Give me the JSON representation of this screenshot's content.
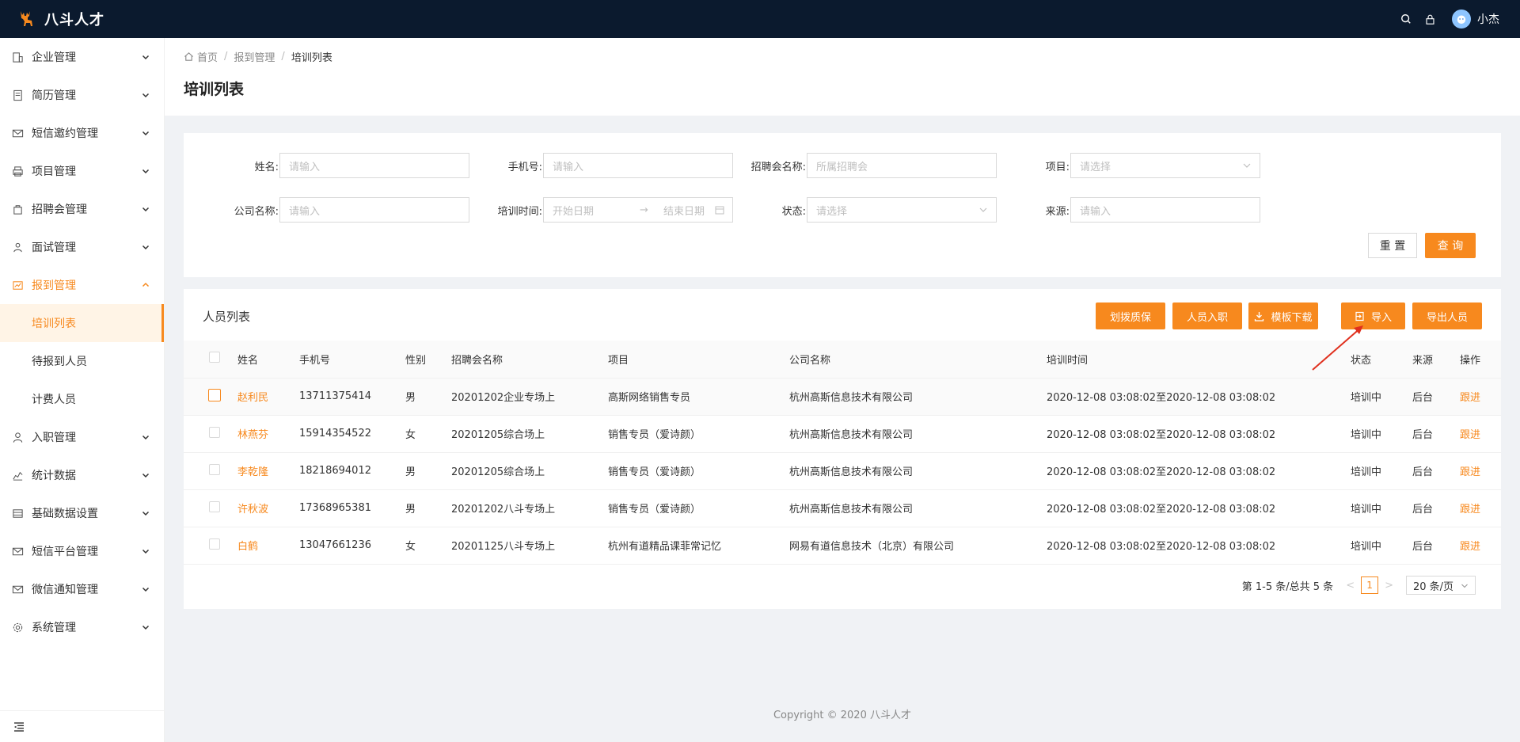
{
  "app": {
    "name": "八斗人才",
    "username": "小杰"
  },
  "colors": {
    "accent": "#f7891e",
    "topbar": "#0b1a2e"
  },
  "sidebar": {
    "items": [
      {
        "label": "企业管理",
        "icon": "building-icon"
      },
      {
        "label": "简历管理",
        "icon": "document-icon"
      },
      {
        "label": "短信邀约管理",
        "icon": "mail-icon"
      },
      {
        "label": "项目管理",
        "icon": "printer-icon"
      },
      {
        "label": "招聘会管理",
        "icon": "bag-icon"
      },
      {
        "label": "面试管理",
        "icon": "people-icon"
      },
      {
        "label": "报到管理",
        "icon": "chart-icon"
      },
      {
        "label": "入职管理",
        "icon": "user-icon"
      },
      {
        "label": "统计数据",
        "icon": "stats-icon"
      },
      {
        "label": "基础数据设置",
        "icon": "database-icon"
      },
      {
        "label": "短信平台管理",
        "icon": "mail-icon"
      },
      {
        "label": "微信通知管理",
        "icon": "mail-icon"
      },
      {
        "label": "系统管理",
        "icon": "gear-icon"
      }
    ],
    "sub_items": [
      "培训列表",
      "待报到人员",
      "计费人员"
    ]
  },
  "breadcrumb": {
    "home": "首页",
    "parent": "报到管理",
    "current": "培训列表"
  },
  "page_title": "培训列表",
  "search": {
    "name_label": "姓名:",
    "name_placeholder": "请输入",
    "phone_label": "手机号:",
    "phone_placeholder": "请输入",
    "fair_label": "招聘会名称:",
    "fair_placeholder": "所属招聘会",
    "project_label": "项目:",
    "project_placeholder": "请选择",
    "company_label": "公司名称:",
    "company_placeholder": "请输入",
    "time_label": "培训时间:",
    "start_placeholder": "开始日期",
    "end_placeholder": "结束日期",
    "status_label": "状态:",
    "status_placeholder": "请选择",
    "source_label": "来源:",
    "source_placeholder": "请输入",
    "reset_label": "重 置",
    "query_label": "查 询"
  },
  "list": {
    "title": "人员列表",
    "buttons": [
      "划拨质保",
      "人员入职",
      "模板下载",
      "导入",
      "导出人员"
    ],
    "columns": [
      "姓名",
      "手机号",
      "性别",
      "招聘会名称",
      "项目",
      "公司名称",
      "培训时间",
      "状态",
      "来源",
      "操作"
    ],
    "rows": [
      {
        "name": "赵利民",
        "phone": "13711375414",
        "gender": "男",
        "fair": "20201202企业专场上",
        "project": "高斯网络销售专员",
        "company": "杭州高斯信息技术有限公司",
        "time": "2020-12-08 03:08:02至2020-12-08 03:08:02",
        "status": "培训中",
        "source": "后台",
        "op": "跟进"
      },
      {
        "name": "林燕芬",
        "phone": "15914354522",
        "gender": "女",
        "fair": "20201205综合场上",
        "project": "销售专员（爱诗颜）",
        "company": "杭州高斯信息技术有限公司",
        "time": "2020-12-08 03:08:02至2020-12-08 03:08:02",
        "status": "培训中",
        "source": "后台",
        "op": "跟进"
      },
      {
        "name": "李乾隆",
        "phone": "18218694012",
        "gender": "男",
        "fair": "20201205综合场上",
        "project": "销售专员（爱诗颜）",
        "company": "杭州高斯信息技术有限公司",
        "time": "2020-12-08 03:08:02至2020-12-08 03:08:02",
        "status": "培训中",
        "source": "后台",
        "op": "跟进"
      },
      {
        "name": "许秋波",
        "phone": "17368965381",
        "gender": "男",
        "fair": "20201202八斗专场上",
        "project": "销售专员（爱诗颜）",
        "company": "杭州高斯信息技术有限公司",
        "time": "2020-12-08 03:08:02至2020-12-08 03:08:02",
        "status": "培训中",
        "source": "后台",
        "op": "跟进"
      },
      {
        "name": "白鹤",
        "phone": "13047661236",
        "gender": "女",
        "fair": "20201125八斗专场上",
        "project": "杭州有道精品课菲常记忆",
        "company": "网易有道信息技术（北京）有限公司",
        "time": "2020-12-08 03:08:02至2020-12-08 03:08:02",
        "status": "培训中",
        "source": "后台",
        "op": "跟进"
      }
    ]
  },
  "pagination": {
    "summary": "第 1-5 条/总共 5 条",
    "current": "1",
    "page_size": "20 条/页"
  },
  "footer": "Copyright © 2020 八斗人才"
}
